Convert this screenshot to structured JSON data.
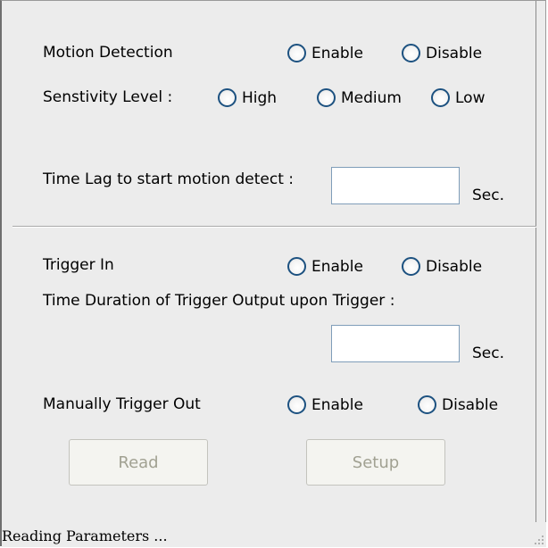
{
  "motion": {
    "label": "Motion Detection",
    "enable": "Enable",
    "disable": "Disable",
    "sensitivity_label": "Senstivity Level :",
    "high": "High",
    "medium": "Medium",
    "low": "Low",
    "time_lag_label": "Time Lag to start motion detect :",
    "time_lag_value": "",
    "unit": "Sec."
  },
  "trigger": {
    "label": "Trigger In",
    "enable": "Enable",
    "disable": "Disable",
    "duration_label": "Time Duration of Trigger Output upon Trigger :",
    "duration_value": "",
    "unit": "Sec.",
    "manual_label": "Manually Trigger Out",
    "manual_enable": "Enable",
    "manual_disable": "Disable"
  },
  "buttons": {
    "read": "Read",
    "setup": "Setup"
  },
  "status": {
    "text": "Reading Parameters ..."
  }
}
